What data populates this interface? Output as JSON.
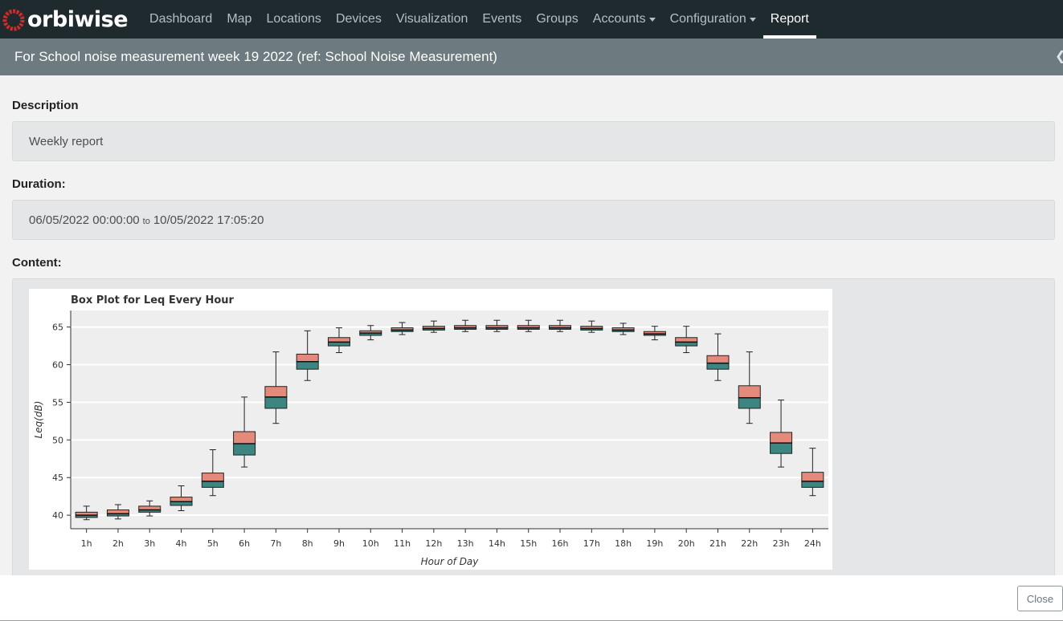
{
  "app": {
    "brand": "orbiwise",
    "brand_color": "#d62a2a"
  },
  "nav": {
    "items": [
      {
        "key": "dashboard",
        "label": "Dashboard",
        "dropdown": false,
        "active": false
      },
      {
        "key": "map",
        "label": "Map",
        "dropdown": false,
        "active": false
      },
      {
        "key": "locations",
        "label": "Locations",
        "dropdown": false,
        "active": false
      },
      {
        "key": "devices",
        "label": "Devices",
        "dropdown": false,
        "active": false
      },
      {
        "key": "visualization",
        "label": "Visualization",
        "dropdown": false,
        "active": false
      },
      {
        "key": "events",
        "label": "Events",
        "dropdown": false,
        "active": false
      },
      {
        "key": "groups",
        "label": "Groups",
        "dropdown": false,
        "active": false
      },
      {
        "key": "accounts",
        "label": "Accounts",
        "dropdown": true,
        "active": false
      },
      {
        "key": "configuration",
        "label": "Configuration",
        "dropdown": true,
        "active": false
      },
      {
        "key": "report",
        "label": "Report",
        "dropdown": false,
        "active": true
      }
    ]
  },
  "modal": {
    "title": "For School noise measurement week 19 2022 (ref: School Noise Measurement)",
    "collapse_icon": "chevron-left-icon",
    "description_label": "Description",
    "description_value": "Weekly report",
    "duration_label": "Duration:",
    "duration_start": "06/05/2022 00:00:00",
    "duration_sep": "to",
    "duration_end": "10/05/2022 17:05:20",
    "content_label": "Content:",
    "close_label": "Close"
  },
  "chart_data": {
    "type": "box",
    "title": "Box Plot for Leq Every Hour",
    "xlabel": "Hour of Day",
    "ylabel": "Leq(dB)",
    "ylim": [
      38.2,
      67.2
    ],
    "yticks": [
      40,
      45,
      50,
      55,
      60,
      65
    ],
    "grid": true,
    "colors": {
      "upper_box": "#e48a7a",
      "lower_box": "#3c8580",
      "background": "#eeeeee"
    },
    "categories": [
      "1h",
      "2h",
      "3h",
      "4h",
      "5h",
      "6h",
      "7h",
      "8h",
      "9h",
      "10h",
      "11h",
      "12h",
      "13h",
      "14h",
      "15h",
      "16h",
      "17h",
      "18h",
      "19h",
      "20h",
      "21h",
      "22h",
      "23h",
      "24h"
    ],
    "boxes": [
      {
        "min": 39.4,
        "q1": 39.7,
        "median": 40.0,
        "q3": 40.4,
        "max": 41.2
      },
      {
        "min": 39.5,
        "q1": 39.9,
        "median": 40.2,
        "q3": 40.7,
        "max": 41.4
      },
      {
        "min": 39.9,
        "q1": 40.4,
        "median": 40.7,
        "q3": 41.2,
        "max": 41.9
      },
      {
        "min": 40.6,
        "q1": 41.3,
        "median": 41.8,
        "q3": 42.4,
        "max": 43.9
      },
      {
        "min": 42.6,
        "q1": 43.7,
        "median": 44.5,
        "q3": 45.6,
        "max": 48.7
      },
      {
        "min": 46.4,
        "q1": 48.0,
        "median": 49.5,
        "q3": 51.1,
        "max": 55.7
      },
      {
        "min": 52.2,
        "q1": 54.2,
        "median": 55.7,
        "q3": 57.1,
        "max": 61.7
      },
      {
        "min": 57.9,
        "q1": 59.4,
        "median": 60.4,
        "q3": 61.4,
        "max": 64.5
      },
      {
        "min": 61.6,
        "q1": 62.5,
        "median": 63.0,
        "q3": 63.6,
        "max": 64.9
      },
      {
        "min": 63.3,
        "q1": 63.9,
        "median": 64.2,
        "q3": 64.5,
        "max": 65.2
      },
      {
        "min": 64.0,
        "q1": 64.4,
        "median": 64.6,
        "q3": 64.9,
        "max": 65.6
      },
      {
        "min": 64.3,
        "q1": 64.6,
        "median": 64.8,
        "q3": 65.1,
        "max": 65.8
      },
      {
        "min": 64.4,
        "q1": 64.7,
        "median": 64.9,
        "q3": 65.2,
        "max": 65.9
      },
      {
        "min": 64.4,
        "q1": 64.7,
        "median": 64.9,
        "q3": 65.2,
        "max": 65.9
      },
      {
        "min": 64.4,
        "q1": 64.7,
        "median": 64.9,
        "q3": 65.2,
        "max": 65.9
      },
      {
        "min": 64.4,
        "q1": 64.7,
        "median": 64.9,
        "q3": 65.2,
        "max": 65.9
      },
      {
        "min": 64.3,
        "q1": 64.6,
        "median": 64.8,
        "q3": 65.1,
        "max": 65.8
      },
      {
        "min": 64.0,
        "q1": 64.4,
        "median": 64.6,
        "q3": 64.9,
        "max": 65.5
      },
      {
        "min": 63.3,
        "q1": 63.9,
        "median": 64.1,
        "q3": 64.4,
        "max": 65.1
      },
      {
        "min": 61.6,
        "q1": 62.5,
        "median": 63.0,
        "q3": 63.6,
        "max": 65.1
      },
      {
        "min": 57.9,
        "q1": 59.4,
        "median": 60.2,
        "q3": 61.2,
        "max": 64.1
      },
      {
        "min": 52.2,
        "q1": 54.2,
        "median": 55.6,
        "q3": 57.2,
        "max": 61.7
      },
      {
        "min": 46.4,
        "q1": 48.2,
        "median": 49.6,
        "q3": 51.0,
        "max": 55.3
      },
      {
        "min": 42.6,
        "q1": 43.7,
        "median": 44.5,
        "q3": 45.7,
        "max": 48.9
      }
    ]
  }
}
